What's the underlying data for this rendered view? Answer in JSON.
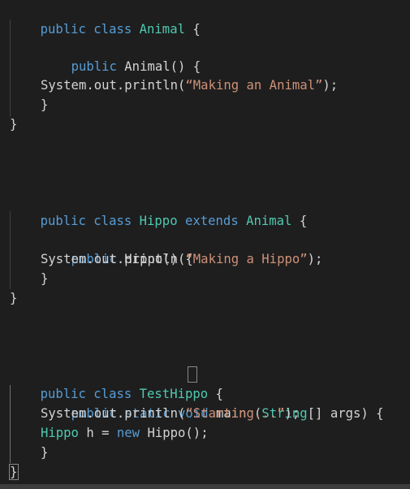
{
  "editor": {
    "lines": {
      "l1": {
        "kw1": "public",
        "kw2": "class",
        "cls": "Animal",
        "brace": "{"
      },
      "l3": {
        "kw1": "public",
        "fn": "Animal",
        "rest": "() {"
      },
      "l5": {
        "a": "System",
        "b": ".",
        "c": "out",
        "d": ".",
        "e": "println",
        "f": "(",
        "str": "“Making an Animal”",
        "g": ");"
      },
      "l6": {
        "brace": "}"
      },
      "l7": {
        "brace": "}"
      },
      "l11": {
        "kw1": "public",
        "kw2": "class",
        "cls": "Hippo",
        "kw3": "extends",
        "cls2": "Animal",
        "brace": "{"
      },
      "l13": {
        "kw1": "public",
        "fn": "Hippo",
        "rest": "() {"
      },
      "l14": {
        "a": "System",
        "b": ".",
        "c": "out",
        "d": ".",
        "e": "println",
        "f": "(",
        "str": "“Making a Hippo”",
        "g": ");"
      },
      "l15": {
        "brace": "}"
      },
      "l16": {
        "brace": "}"
      },
      "l20": {
        "kw1": "public",
        "kw2": "class",
        "cls": "TestHippo",
        "brace": "{"
      },
      "l21": {
        "kw1": "public",
        "kw2": "static",
        "kw3": "void",
        "fn": "main",
        "p1": " (",
        "type": "String",
        "p2": "[] args) {"
      },
      "l22": {
        "a": "System",
        "b": ".",
        "c": "out",
        "d": ".",
        "e": "println",
        "f": "(",
        "str": "“Starting...”",
        "g": ");"
      },
      "l23": {
        "type": "Hippo",
        "var": " h = ",
        "kw": "new",
        "fn": "Hippo",
        "rest": "();"
      },
      "l24": {
        "brace": "}"
      },
      "l25": {
        "brace": "}"
      }
    }
  },
  "colors": {
    "background": "#1e1e1e",
    "keyword": "#569cd6",
    "type": "#4ec9b0",
    "string": "#ce9178",
    "function": "#dcdcaa",
    "plain": "#d4d4d4"
  }
}
